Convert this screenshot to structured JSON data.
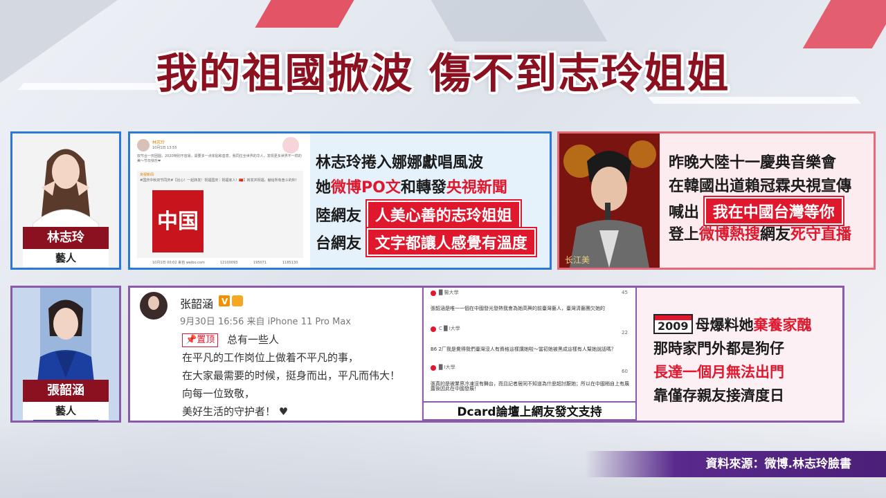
{
  "headline": "我的祖國掀波 傷不到志玲姐姐",
  "person1": {
    "name": "林志玲",
    "role": "藝人"
  },
  "person2": {
    "name": "張韶涵",
    "role": "藝人"
  },
  "weibo_shot1": {
    "user": "林志玲",
    "time": "10月1日 13:55",
    "text1": "双节合一庆团圆，2020特别不容易，需要多一点体贴和善意，我同往全世界的华人，发现更多世界不一样的美～节日快乐❤",
    "repost_user": "央视新闻",
    "repost_text": "#国庆中秋双节同庆#【比心！一起转发！祝福国庆｜祝福家人！🇨🇳】转发并祝福，献给所有奋斗的你！",
    "poster_caption": "中国",
    "footer": "10月1日 00:02 来自 weibo.com",
    "stats": [
      "12100093",
      "195071",
      "1185130"
    ]
  },
  "box1": {
    "line1": "林志玲捲入娜娜獻唱風波",
    "line2_a": "她",
    "line2_b": "微博PO文",
    "line2_c": "和轉發",
    "line2_d": "央視新聞",
    "line3_label": "陸網友",
    "line3_box": "人美心善的志玲姐姐",
    "line4_label": "台網友",
    "line4_box": "文字都讓人感覺有溫度"
  },
  "singer_caption": "长江美",
  "box2": {
    "line1": "昨晚大陸十一慶典音樂會",
    "line2": "在韓國出道賴冠霖央視宣傳",
    "line3_label": "喊出",
    "line3_box": "我在中國台灣等你",
    "line4_a": "登上",
    "line4_b": "微博熱搜",
    "line4_c": "網友",
    "line4_d": "死守直播"
  },
  "zhang_weibo": {
    "username": "张韶涵",
    "meta": "9月30日 16:56 来自 iPhone 11 Pro Max",
    "pin_label": "置顶",
    "line1": "总有一些人",
    "line2": "在平凡的工作岗位上做着不平凡的事，",
    "line3": "在大家最需要的时候，挺身而出，平凡而伟大！",
    "line4": "向每一位致敬，",
    "line5": "美好生活的守护者！"
  },
  "dcard": {
    "c1_school": "█ 醫大學",
    "c1_text": "張韶涵是唯一一個在中國發光發熱我會為她高興的前臺灣藝人，臺灣清藝團欠她的",
    "c1_likes": "45",
    "c2_school": "C █ I大學",
    "c2_text": "B6 2厂我是覺得我們臺灣沒人有資格這樣講她啦～當初她被黑成這樣有人幫她說話嗎？",
    "c2_likes": "22",
    "c3_school": "█ I大學",
    "c3_text": "張真的是被業界冷凍沒有舞台，而且記者居同不知道為什麼超討厭她；所以在中國稍自上有展露後因此在中國發展！",
    "c3_likes": "60",
    "caption": "Dcard論壇上網友發文支持"
  },
  "box3": {
    "year": "2009",
    "line1_a": "母爆料她",
    "line1_b": "棄養家醜",
    "line2": "那時家門外都是狗仔",
    "line3": "長達一個月無法出門",
    "line4": "靠僅存親友接濟度日"
  },
  "source": "資料來源：微博.林志玲臉書"
}
